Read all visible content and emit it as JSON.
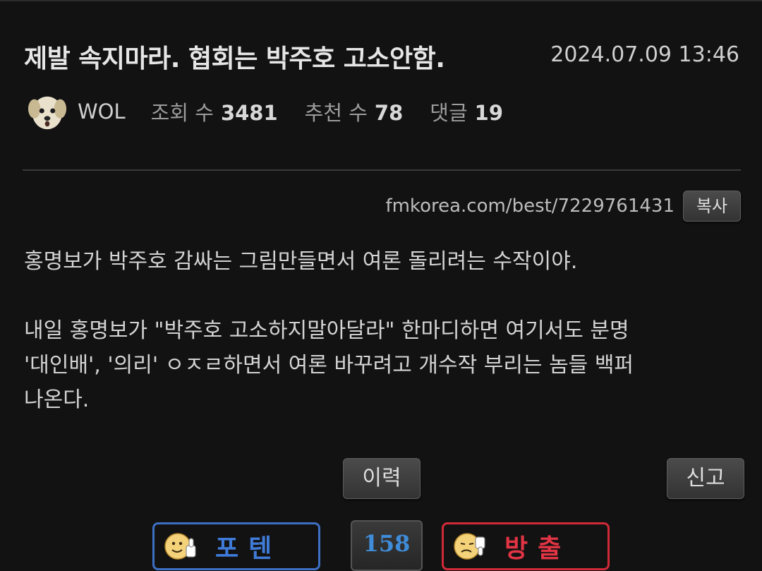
{
  "post": {
    "title": "제발 속지마라. 협회는 박주호 고소안함.",
    "datetime": "2024.07.09 13:46",
    "author": "WOL",
    "views_label": "조회 수",
    "views": "3481",
    "recommend_label": "추천 수",
    "recommend": "78",
    "comments_label": "댓글",
    "comments": "19",
    "url": "fmkorea.com/best/7229761431",
    "copy_label": "복사",
    "body": {
      "p1": "홍명보가 박주호 감싸는 그림만들면서 여론 돌리려는 수작이야.",
      "p2_line1": "내일 홍명보가 \"박주호 고소하지말아달라\" 한마디하면 여기서도 분명",
      "p2_line2": "'대인배', '의리' ㅇㅈㄹ하면서 여론 바꾸려고 개수작 부리는 놈들 백퍼",
      "p2_line3": "나온다."
    }
  },
  "actions": {
    "history_label": "이력",
    "report_label": "신고",
    "upvote_label": "포텐",
    "downvote_label": "방출",
    "vote_count": "158"
  },
  "colors": {
    "background": "#121212",
    "upvote": "#3f7bd8",
    "downvote": "#e23444"
  },
  "icons": {
    "author_avatar": "dog-face-icon",
    "upvote": "thumbs-up-face-icon",
    "downvote": "thumbs-down-face-icon"
  }
}
